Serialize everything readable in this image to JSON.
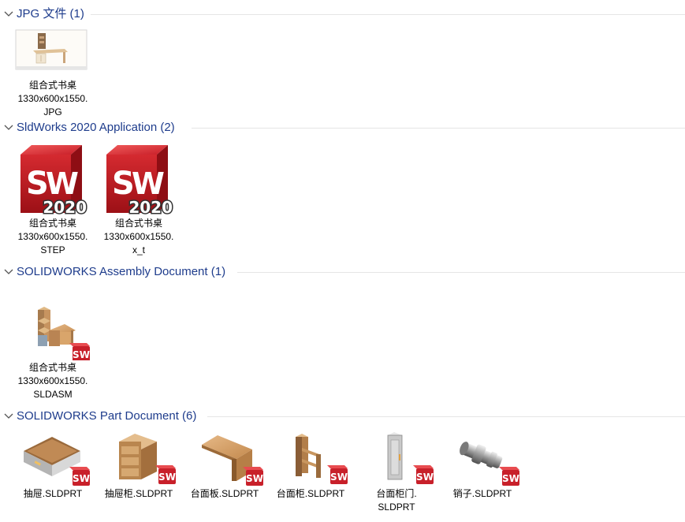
{
  "groups": [
    {
      "title": "JPG 文件 (1)",
      "items": [
        {
          "name": "组合式书桌\n1330x600x1550.\nJPG",
          "icon": "desk-photo-thumbnail"
        }
      ]
    },
    {
      "title": "SldWorks 2020 Application (2)",
      "items": [
        {
          "name": "组合式书桌\n1330x600x1550.\nSTEP",
          "icon": "solidworks-2020-icon"
        },
        {
          "name": "组合式书桌\n1330x600x1550.\nx_t",
          "icon": "solidworks-2020-icon"
        }
      ],
      "badge_text": "2020",
      "logo_text": "SW"
    },
    {
      "title": "SOLIDWORKS Assembly Document (1)",
      "items": [
        {
          "name": "组合式书桌\n1330x600x1550.\nSLDASM",
          "icon": "desk-assembly-thumbnail"
        }
      ]
    },
    {
      "title": "SOLIDWORKS Part Document (6)",
      "items": [
        {
          "name": "抽屉.SLDPRT",
          "icon": "drawer-thumbnail"
        },
        {
          "name": "抽屉柜.SLDPRT",
          "icon": "drawer-cabinet-thumbnail"
        },
        {
          "name": "台面板.SLDPRT",
          "icon": "desk-top-thumbnail"
        },
        {
          "name": "台面柜.SLDPRT",
          "icon": "desk-cabinet-thumbnail"
        },
        {
          "name": "台面柜门.\nSLDPRT",
          "icon": "cabinet-door-thumbnail"
        },
        {
          "name": "销子.SLDPRT",
          "icon": "pin-thumbnail"
        }
      ]
    }
  ],
  "colors": {
    "group_title": "#1e3c8c",
    "sw_red": "#c8202a",
    "wood": "#d9a56b"
  }
}
